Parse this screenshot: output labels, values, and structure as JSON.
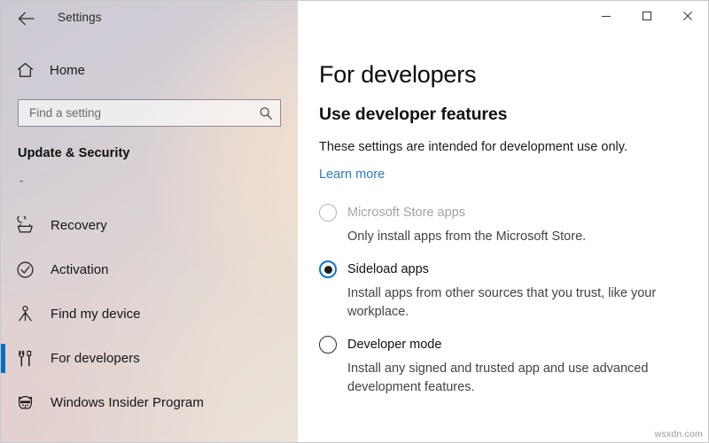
{
  "window": {
    "title": "Settings",
    "back_icon": "back-arrow-icon",
    "controls": {
      "minimize": "─",
      "maximize": "□",
      "close": "✕"
    }
  },
  "sidebar": {
    "home": {
      "label": "Home",
      "icon": "home-icon"
    },
    "search": {
      "placeholder": "Find a setting",
      "value": "",
      "icon": "search-icon"
    },
    "group_header": "Update & Security",
    "group_dash": "-",
    "items": [
      {
        "label": "Recovery",
        "icon": "recovery-icon",
        "selected": false
      },
      {
        "label": "Activation",
        "icon": "activation-check-icon",
        "selected": false
      },
      {
        "label": "Find my device",
        "icon": "find-my-device-icon",
        "selected": false
      },
      {
        "label": "For developers",
        "icon": "developer-tools-icon",
        "selected": true
      },
      {
        "label": "Windows Insider Program",
        "icon": "ninjacat-icon",
        "selected": false
      }
    ],
    "accent_color": "#0a6cc4"
  },
  "main": {
    "page_title": "For developers",
    "section_title": "Use developer features",
    "description": "These settings are intended for development use only.",
    "learn_more": "Learn more",
    "learn_more_color": "#2a7bc0",
    "options": [
      {
        "label": "Microsoft Store apps",
        "description": "Only install apps from the Microsoft Store.",
        "selected": false,
        "disabled": true
      },
      {
        "label": "Sideload apps",
        "description": "Install apps from other sources that you trust, like your workplace.",
        "selected": true,
        "disabled": false
      },
      {
        "label": "Developer mode",
        "description": "Install any signed and trusted app and use advanced development features.",
        "selected": false,
        "disabled": false
      }
    ]
  },
  "watermark": "wsxdn.com"
}
